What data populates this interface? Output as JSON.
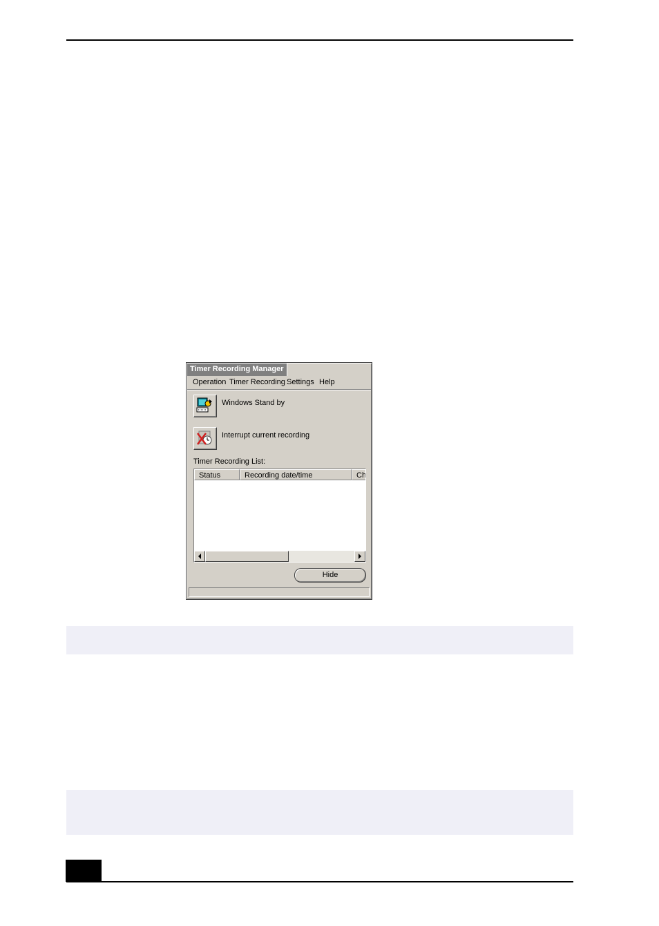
{
  "window": {
    "title": "Timer Recording Manager",
    "menu": [
      "Operation",
      "Timer Recording",
      "Settings",
      "Help"
    ],
    "actions": {
      "standby_label": "Windows Stand by",
      "interrupt_label": "Interrupt current recording"
    },
    "list": {
      "label": "Timer Recording List:",
      "columns": [
        "Status",
        "Recording date/time",
        "Ch"
      ]
    },
    "hide_label": "Hide",
    "status_text": ""
  },
  "colors": {
    "window_face": "#d4d0c8",
    "note_background": "#efeff7",
    "rule": "#000000"
  }
}
